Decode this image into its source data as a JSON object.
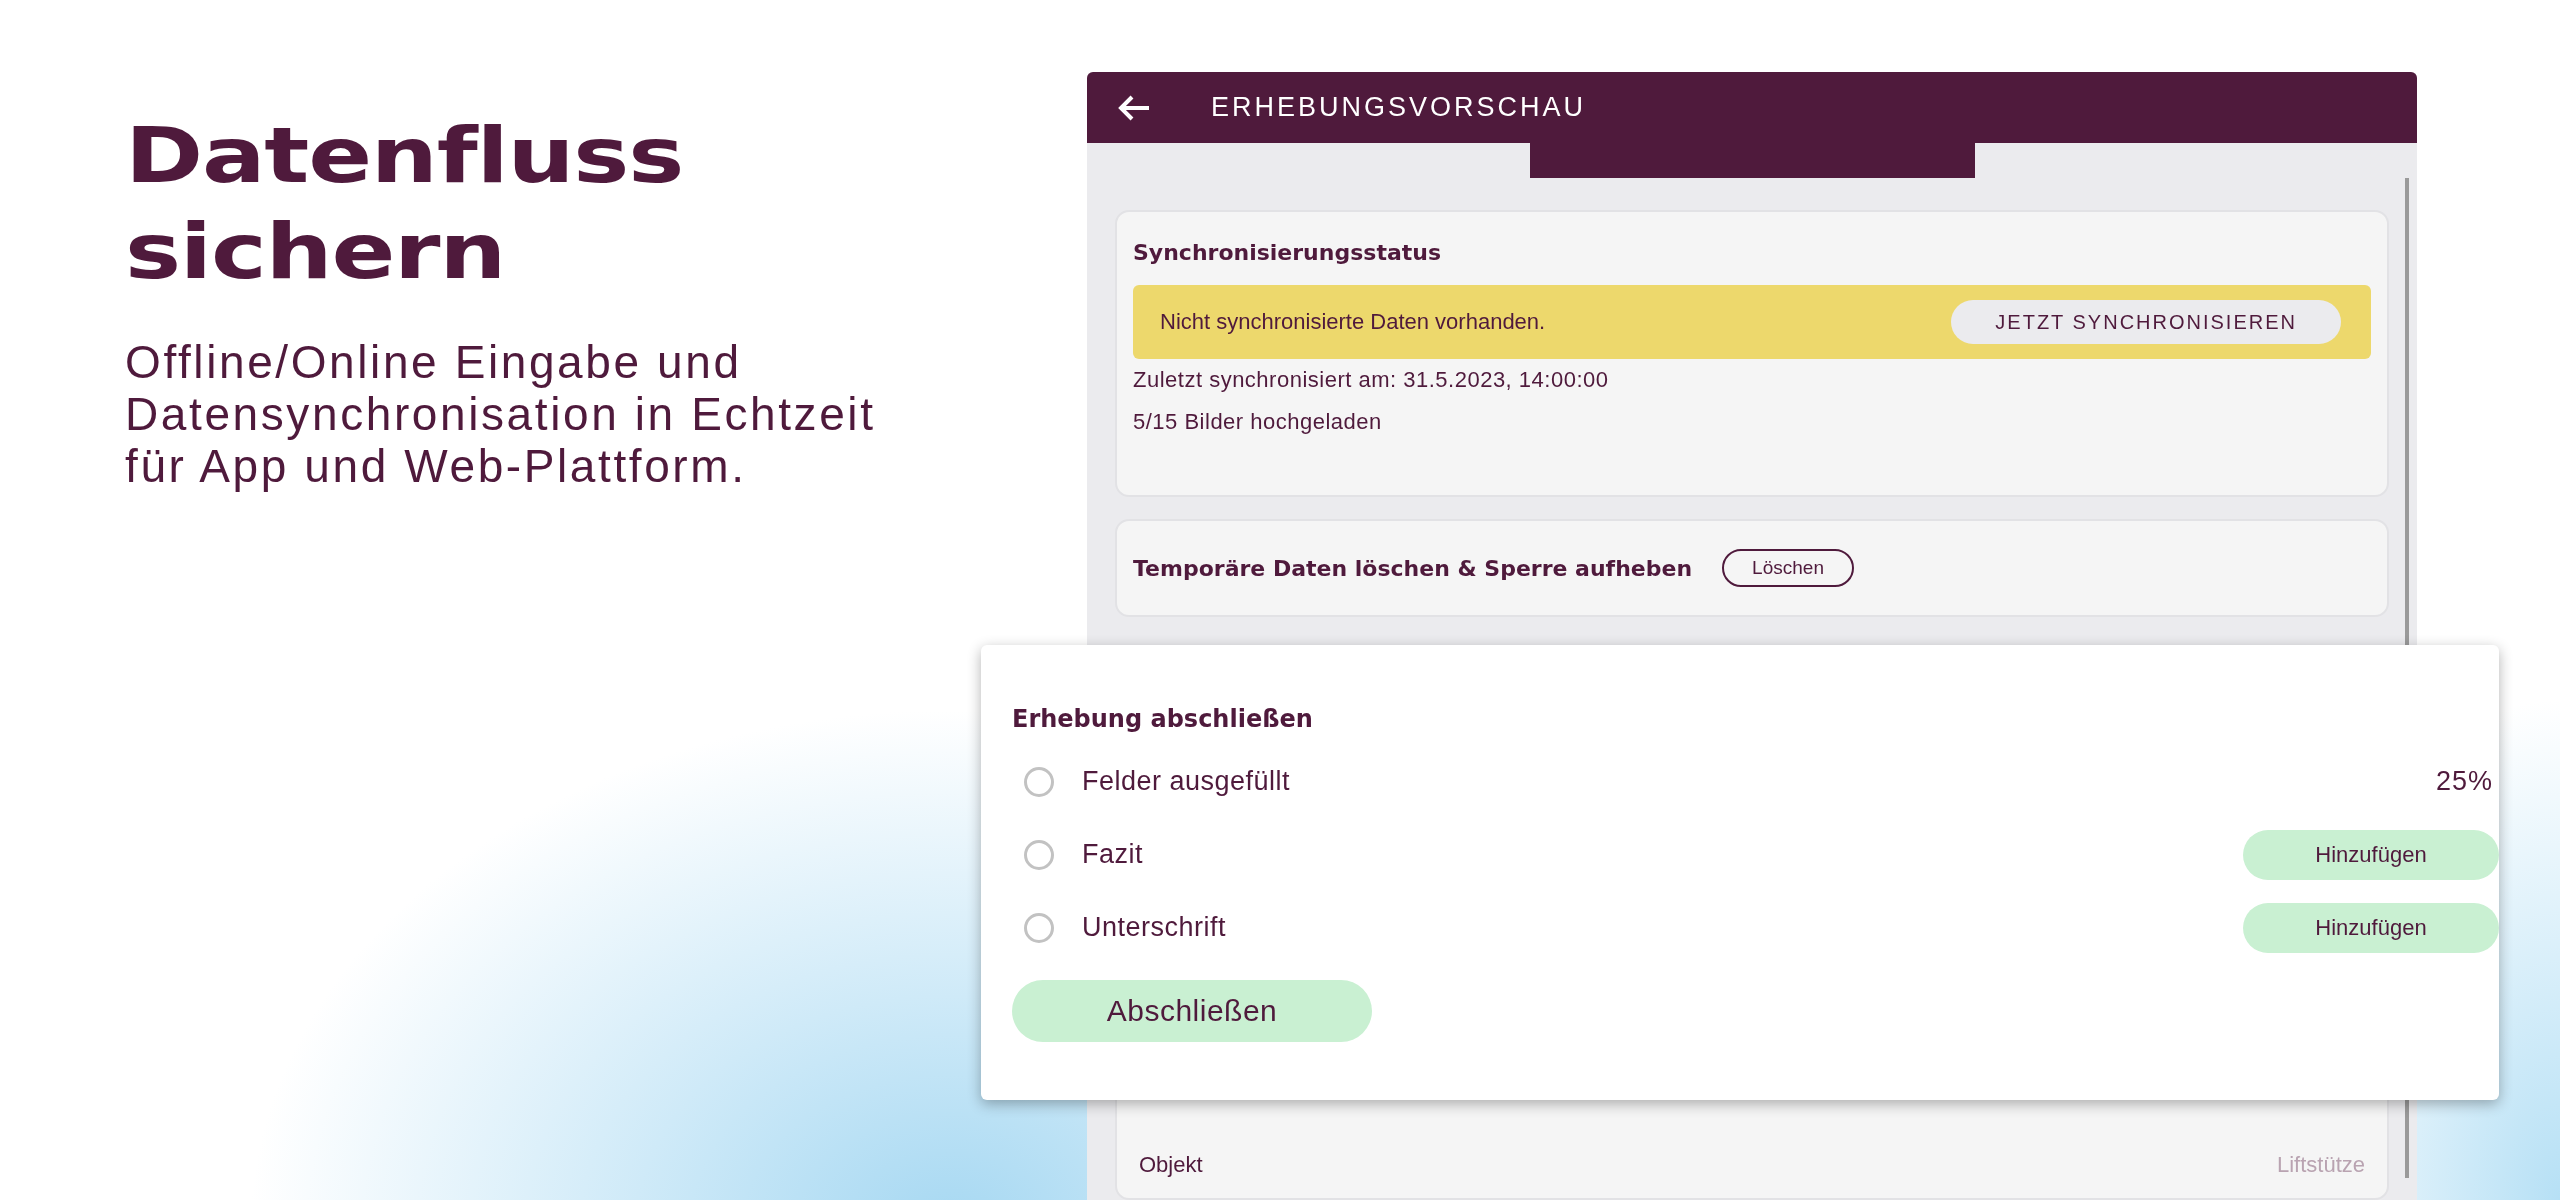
{
  "promo": {
    "title_lines": [
      "Datenfluss",
      "sichern"
    ],
    "subtitle_lines": [
      "Offline/Online Eingabe und",
      "Datensynchronisation in Echtzeit",
      "für App und Web-Plattform."
    ]
  },
  "app": {
    "header": {
      "title": "ERHEBUNGSVORSCHAU"
    },
    "sync_card": {
      "title": "Synchronisierungsstatus",
      "banner": {
        "text": "Nicht synchronisierte Daten vorhanden.",
        "button": "JETZT SYNCHRONISIEREN"
      },
      "last_sync": "Zuletzt synchronisiert am: 31.5.2023, 14:00:00",
      "images": "5/15 Bilder hochgeladen"
    },
    "temp_card": {
      "title": "Temporäre Daten löschen & Sperre aufheben",
      "button": "Löschen"
    },
    "overview": {
      "rows": [
        {
          "label": "Objekt",
          "value": "Liftstütze"
        }
      ]
    }
  },
  "dialog": {
    "title": "Erhebung abschließen",
    "items": [
      {
        "kind": "percent",
        "label": "Felder ausgefüllt",
        "checked": false,
        "value": "25%"
      },
      {
        "kind": "action",
        "label": "Fazit",
        "checked": false,
        "button": "Hinzufügen"
      },
      {
        "kind": "action",
        "label": "Unterschrift",
        "checked": false,
        "button": "Hinzufügen"
      }
    ],
    "button": "Abschließen"
  }
}
